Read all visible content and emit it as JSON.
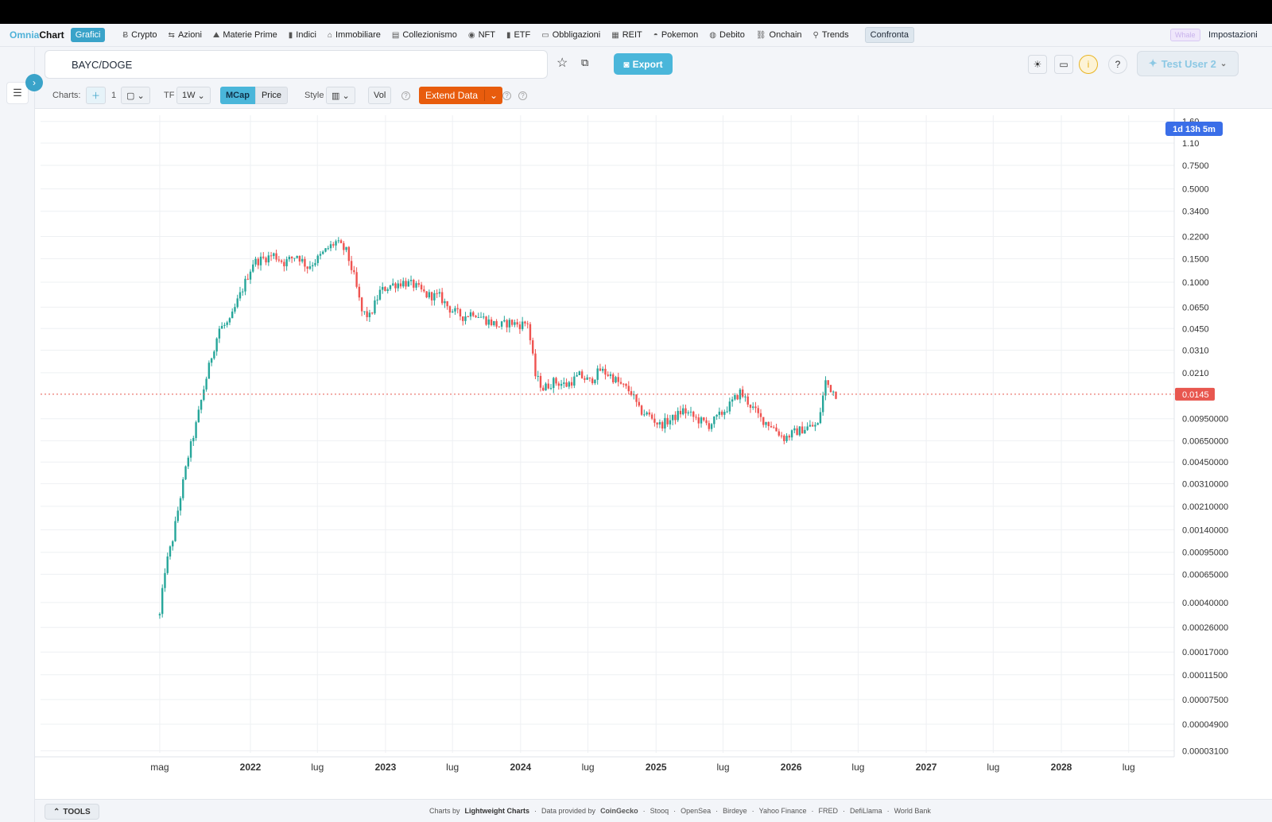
{
  "brand": {
    "part1": "Omnia",
    "part2": "Chart",
    "tag": "Grafici"
  },
  "nav": {
    "items": [
      {
        "label": "Crypto",
        "icon": "bitcoin-icon"
      },
      {
        "label": "Azioni",
        "icon": "arrows-icon"
      },
      {
        "label": "Materie Prime",
        "icon": "mountain-icon"
      },
      {
        "label": "Indici",
        "icon": "bar-chart-icon"
      },
      {
        "label": "Immobiliare",
        "icon": "house-icon"
      },
      {
        "label": "Collezionismo",
        "icon": "book-icon"
      },
      {
        "label": "NFT",
        "icon": "nft-icon"
      },
      {
        "label": "ETF",
        "icon": "bar-chart-icon"
      },
      {
        "label": "Obbligazioni",
        "icon": "banknote-icon"
      },
      {
        "label": "REIT",
        "icon": "building-icon"
      },
      {
        "label": "Pokemon",
        "icon": "pokeball-icon"
      },
      {
        "label": "Debito",
        "icon": "globe-icon"
      },
      {
        "label": "Onchain",
        "icon": "chain-icon"
      },
      {
        "label": "Trends",
        "icon": "magnifier-icon"
      }
    ],
    "confronta": "Confronta",
    "whale": "Whale",
    "impostazioni": "Impostazioni"
  },
  "header": {
    "symbol": "BAYC/DOGE",
    "export": "Export",
    "user": "Test User 2"
  },
  "toolbar": {
    "charts_label": "Charts:",
    "charts_count": "1",
    "tf_label": "TF",
    "tf_value": "1W",
    "mcap": "MCap",
    "price": "Price",
    "style_label": "Style",
    "vol": "Vol",
    "extend": "Extend Data"
  },
  "footer": {
    "tools": "TOOLS",
    "charts_by": "Charts by",
    "lib": "Lightweight Charts",
    "provided": "Data provided by",
    "sources": [
      "CoinGecko",
      "Stooq",
      "OpenSea",
      "Birdeye",
      "Yahoo Finance",
      "FRED",
      "DefiLlama",
      "World Bank"
    ]
  },
  "chart_data": {
    "type": "candlestick",
    "title": "BAYC/DOGE",
    "scale": "log",
    "timeframe": "1W",
    "y_ticks": [
      "1.60",
      "1.10",
      "0.7500",
      "0.5000",
      "0.3400",
      "0.2200",
      "0.1500",
      "0.1000",
      "0.0650",
      "0.0450",
      "0.0310",
      "0.0210",
      "0.00950000",
      "0.00650000",
      "0.00450000",
      "0.00310000",
      "0.00210000",
      "0.00140000",
      "0.00095000",
      "0.00065000",
      "0.00040000",
      "0.00026000",
      "0.00017000",
      "0.00011500",
      "0.00007500",
      "0.00004900",
      "0.00003100"
    ],
    "x_ticks": [
      "mag",
      "2022",
      "lug",
      "2023",
      "lug",
      "2024",
      "lug",
      "2025",
      "lug",
      "2026",
      "lug",
      "2027",
      "lug",
      "2028",
      "lug"
    ],
    "last_price": "0.0145",
    "countdown": "1d 13h 5m",
    "colors": {
      "up": "#26a69a",
      "down": "#ef5350",
      "last": "#e8574f",
      "countdown": "#3a6ee8"
    },
    "close_path": [
      [
        "2021-05-01",
        0.00032
      ],
      [
        "2021-05-15",
        0.0007
      ],
      [
        "2021-06-05",
        0.0012
      ],
      [
        "2021-06-26",
        0.0025
      ],
      [
        "2021-07-17",
        0.005
      ],
      [
        "2021-08-07",
        0.0085
      ],
      [
        "2021-08-28",
        0.016
      ],
      [
        "2021-09-18",
        0.028
      ],
      [
        "2021-10-09",
        0.045
      ],
      [
        "2021-11-06",
        0.05
      ],
      [
        "2021-11-27",
        0.072
      ],
      [
        "2021-12-18",
        0.1
      ],
      [
        "2022-01-08",
        0.14
      ],
      [
        "2022-02-05",
        0.15
      ],
      [
        "2022-03-05",
        0.16
      ],
      [
        "2022-04-02",
        0.14
      ],
      [
        "2022-05-07",
        0.16
      ],
      [
        "2022-06-04",
        0.13
      ],
      [
        "2022-07-02",
        0.15
      ],
      [
        "2022-07-30",
        0.18
      ],
      [
        "2022-08-20",
        0.2
      ],
      [
        "2022-09-17",
        0.17
      ],
      [
        "2022-10-08",
        0.11
      ],
      [
        "2022-10-29",
        0.06
      ],
      [
        "2022-11-19",
        0.055
      ],
      [
        "2022-12-17",
        0.085
      ],
      [
        "2023-01-14",
        0.095
      ],
      [
        "2023-02-18",
        0.1
      ],
      [
        "2023-03-18",
        0.095
      ],
      [
        "2023-04-22",
        0.08
      ],
      [
        "2023-05-27",
        0.078
      ],
      [
        "2023-06-24",
        0.063
      ],
      [
        "2023-07-29",
        0.055
      ],
      [
        "2023-08-26",
        0.06
      ],
      [
        "2023-09-30",
        0.052
      ],
      [
        "2023-11-04",
        0.047
      ],
      [
        "2023-12-02",
        0.05
      ],
      [
        "2023-12-30",
        0.048
      ],
      [
        "2024-01-20",
        0.05
      ],
      [
        "2024-02-10",
        0.02
      ],
      [
        "2024-03-02",
        0.016
      ],
      [
        "2024-03-30",
        0.018
      ],
      [
        "2024-05-04",
        0.017
      ],
      [
        "2024-06-08",
        0.02
      ],
      [
        "2024-07-06",
        0.018
      ],
      [
        "2024-08-03",
        0.022
      ],
      [
        "2024-08-31",
        0.02
      ],
      [
        "2024-09-28",
        0.017
      ],
      [
        "2024-10-26",
        0.015
      ],
      [
        "2024-11-16",
        0.011
      ],
      [
        "2024-12-14",
        0.01
      ],
      [
        "2025-01-11",
        0.0085
      ],
      [
        "2025-02-15",
        0.0095
      ],
      [
        "2025-03-15",
        0.011
      ],
      [
        "2025-04-19",
        0.0095
      ],
      [
        "2025-05-24",
        0.0085
      ],
      [
        "2025-06-21",
        0.01
      ],
      [
        "2025-07-19",
        0.012
      ],
      [
        "2025-08-16",
        0.015
      ],
      [
        "2025-09-13",
        0.012
      ],
      [
        "2025-10-11",
        0.0095
      ],
      [
        "2025-11-08",
        0.0085
      ],
      [
        "2025-12-13",
        0.0068
      ],
      [
        "2026-01-10",
        0.0075
      ],
      [
        "2026-02-14",
        0.0082
      ],
      [
        "2026-03-14",
        0.0085
      ],
      [
        "2026-04-04",
        0.018
      ],
      [
        "2026-04-18",
        0.016
      ],
      [
        "2026-05-02",
        0.0145
      ]
    ]
  }
}
